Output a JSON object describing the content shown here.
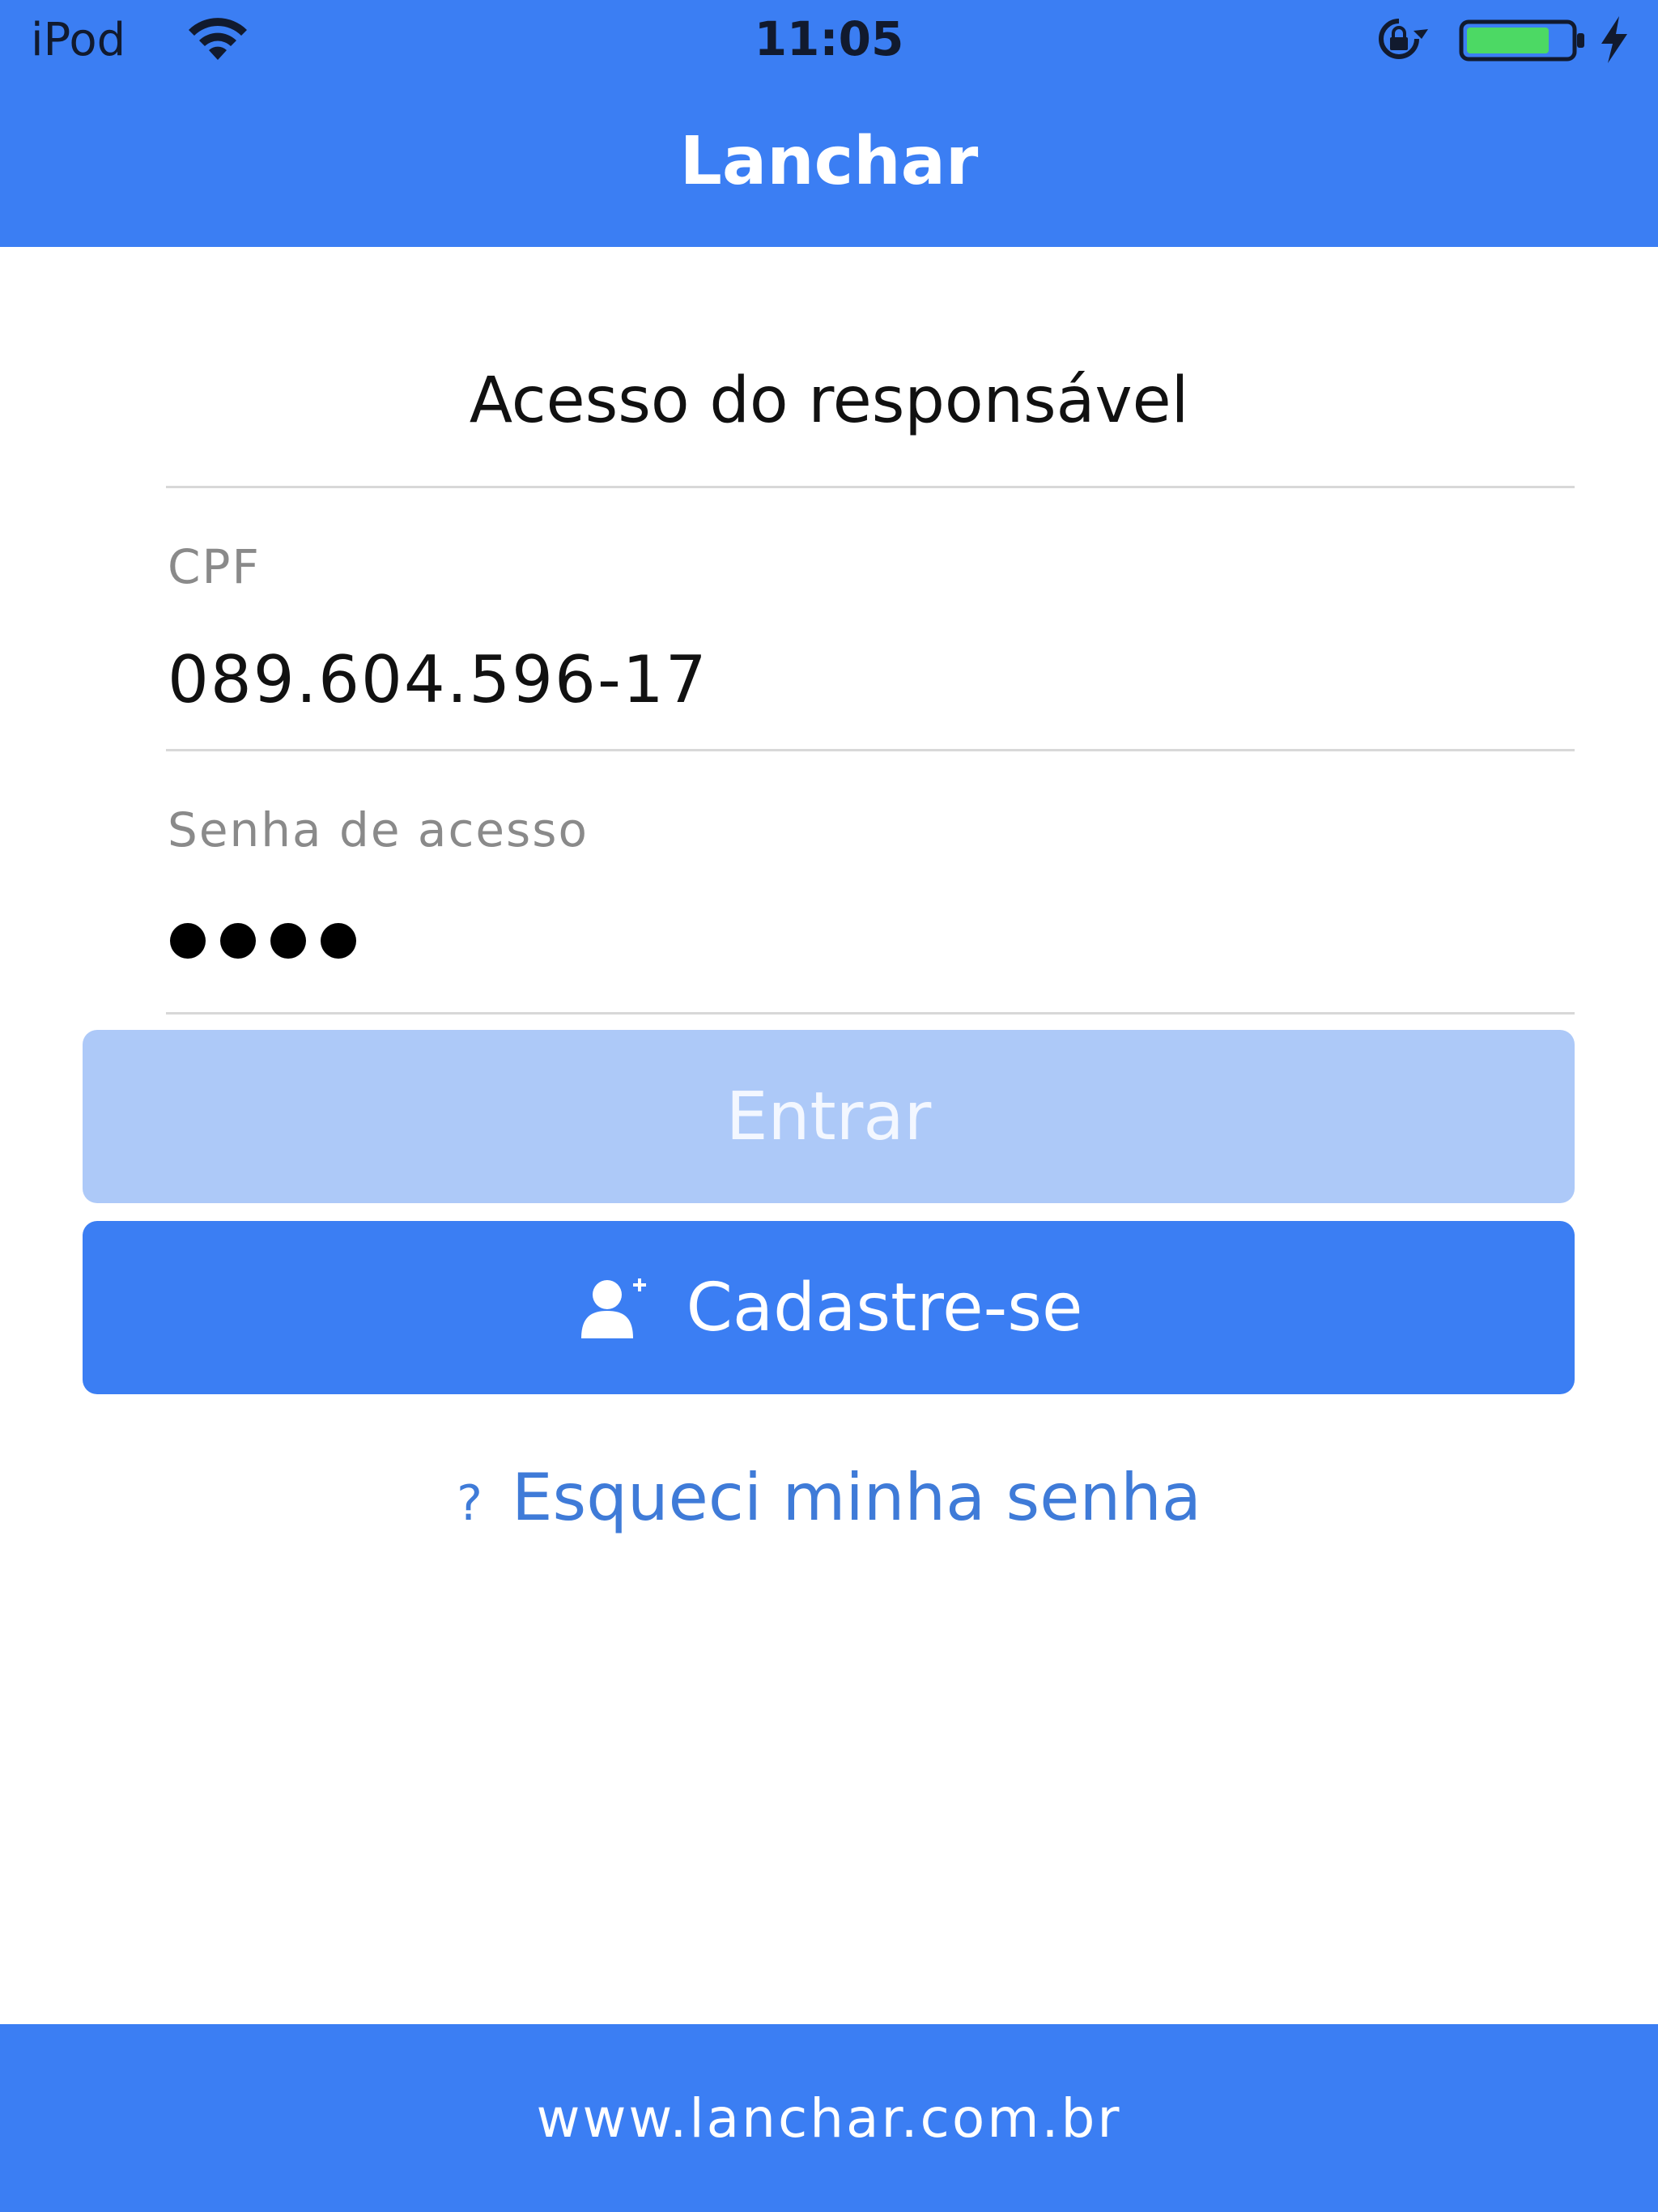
{
  "status_bar": {
    "carrier": "iPod",
    "time": "11:05",
    "icons": [
      "wifi-icon",
      "rotation-lock-icon",
      "battery-icon",
      "charging-bolt-icon"
    ],
    "battery_level": 0.8
  },
  "nav": {
    "title": "Lanchar"
  },
  "form": {
    "section_title": "Acesso do responsável",
    "cpf_label": "CPF",
    "cpf_value": "089.604.596-17",
    "password_label": "Senha de acesso",
    "password_length": 4
  },
  "buttons": {
    "enter_label": "Entrar",
    "register_label": "Cadastre-se",
    "register_icon": "user-add-icon"
  },
  "forgot": {
    "icon_text": "?",
    "label": "Esqueci minha senha"
  },
  "footer": {
    "website": "www.lanchar.com.br"
  },
  "colors": {
    "primary": "#3b7ef3",
    "primary_disabled": "#adc9f8",
    "link": "#3f7bd8",
    "label_gray": "#8a8a8a"
  }
}
